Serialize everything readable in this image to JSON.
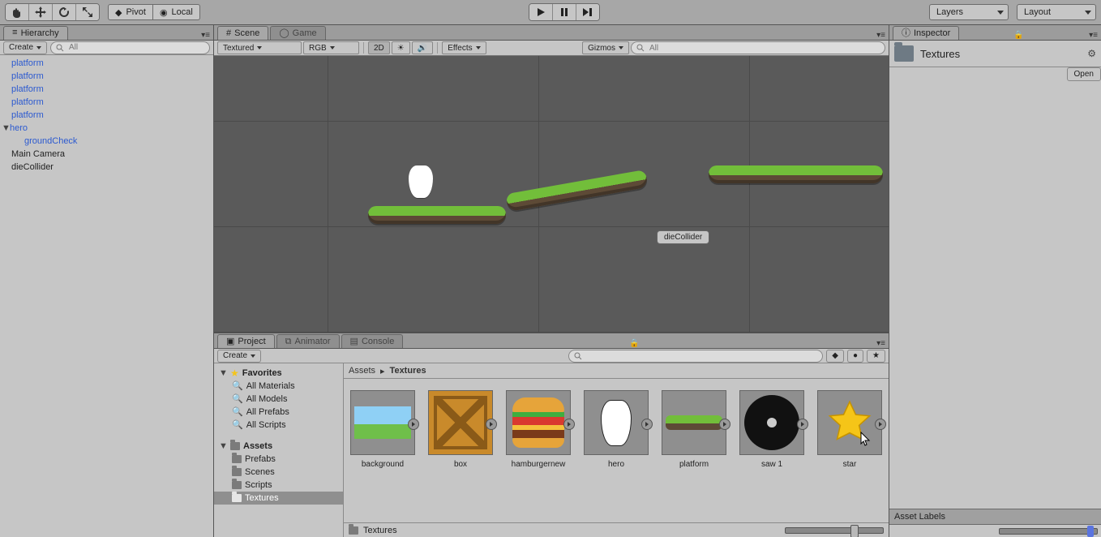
{
  "toolbar": {
    "pivot_label": "Pivot",
    "local_label": "Local",
    "layers_label": "Layers",
    "layout_label": "Layout"
  },
  "hierarchy": {
    "tab": "Hierarchy",
    "create_label": "Create",
    "search_placeholder": "All",
    "items": [
      {
        "label": "platform",
        "kind": "prefab"
      },
      {
        "label": "platform",
        "kind": "prefab"
      },
      {
        "label": "platform",
        "kind": "prefab"
      },
      {
        "label": "platform",
        "kind": "prefab"
      },
      {
        "label": "platform",
        "kind": "prefab"
      },
      {
        "label": "hero",
        "kind": "prefab",
        "fold": "▼"
      },
      {
        "label": "groundCheck",
        "kind": "prefab",
        "child": true
      },
      {
        "label": "Main Camera",
        "kind": "plain"
      },
      {
        "label": "dieCollider",
        "kind": "plain"
      }
    ]
  },
  "scene": {
    "tab_scene": "Scene",
    "tab_game": "Game",
    "shading": "Textured",
    "render": "RGB",
    "mode2d": "2D",
    "effects": "Effects",
    "gizmos": "Gizmos",
    "search_placeholder": "All",
    "dieColliderLabel": "dieCollider"
  },
  "project": {
    "tab_project": "Project",
    "tab_animator": "Animator",
    "tab_console": "Console",
    "create_label": "Create",
    "tree": {
      "favorites": "Favorites",
      "fav_items": [
        "All Materials",
        "All Models",
        "All Prefabs",
        "All Scripts"
      ],
      "assets": "Assets",
      "asset_items": [
        "Prefabs",
        "Scenes",
        "Scripts",
        "Textures"
      ]
    },
    "breadcrumb_root": "Assets",
    "breadcrumb_leaf": "Textures",
    "assets": [
      {
        "name": "background"
      },
      {
        "name": "box"
      },
      {
        "name": "hamburgernew"
      },
      {
        "name": "hero"
      },
      {
        "name": "platform"
      },
      {
        "name": "saw 1"
      },
      {
        "name": "star"
      }
    ],
    "footer": "Textures"
  },
  "inspector": {
    "tab": "Inspector",
    "title": "Textures",
    "open": "Open",
    "asset_labels": "Asset Labels"
  }
}
